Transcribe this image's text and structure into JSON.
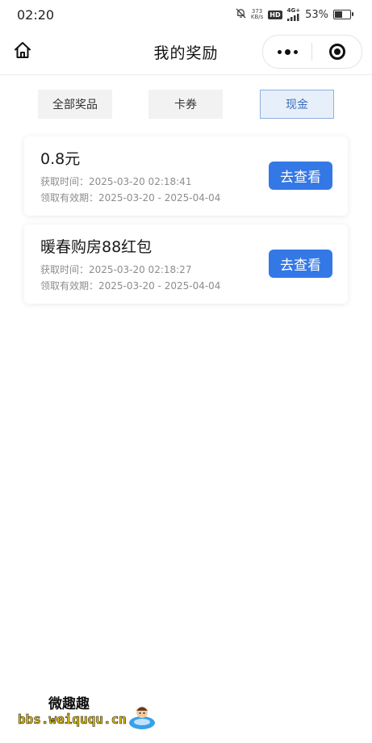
{
  "status_bar": {
    "time": "02:20",
    "net_speed": "373",
    "net_speed_unit": "KB/s",
    "hd": "HD",
    "network": "4G+",
    "battery_percent": "53%",
    "battery_level": 0.53
  },
  "navbar": {
    "title": "我的奖励"
  },
  "tabs": [
    {
      "label": "全部奖品",
      "active": false
    },
    {
      "label": "卡券",
      "active": false
    },
    {
      "label": "现金",
      "active": true
    }
  ],
  "rewards": [
    {
      "title": "0.8元",
      "obtain_time": "获取时间：2025-03-20 02:18:41",
      "valid_period": "领取有效期：2025-03-20 - 2025-04-04",
      "button": "去查看"
    },
    {
      "title": "暖春购房88红包",
      "obtain_time": "获取时间：2025-03-20 02:18:27",
      "valid_period": "领取有效期：2025-03-20 - 2025-04-04",
      "button": "去查看"
    }
  ],
  "watermark": {
    "top_text": "微趣趣",
    "url": "bbs.weiququ.cn"
  },
  "colors": {
    "accent": "#3478e6",
    "active_tab_bg": "#e7effb",
    "active_tab_text": "#3d6fb8",
    "tab_bg": "#f2f2f2"
  }
}
